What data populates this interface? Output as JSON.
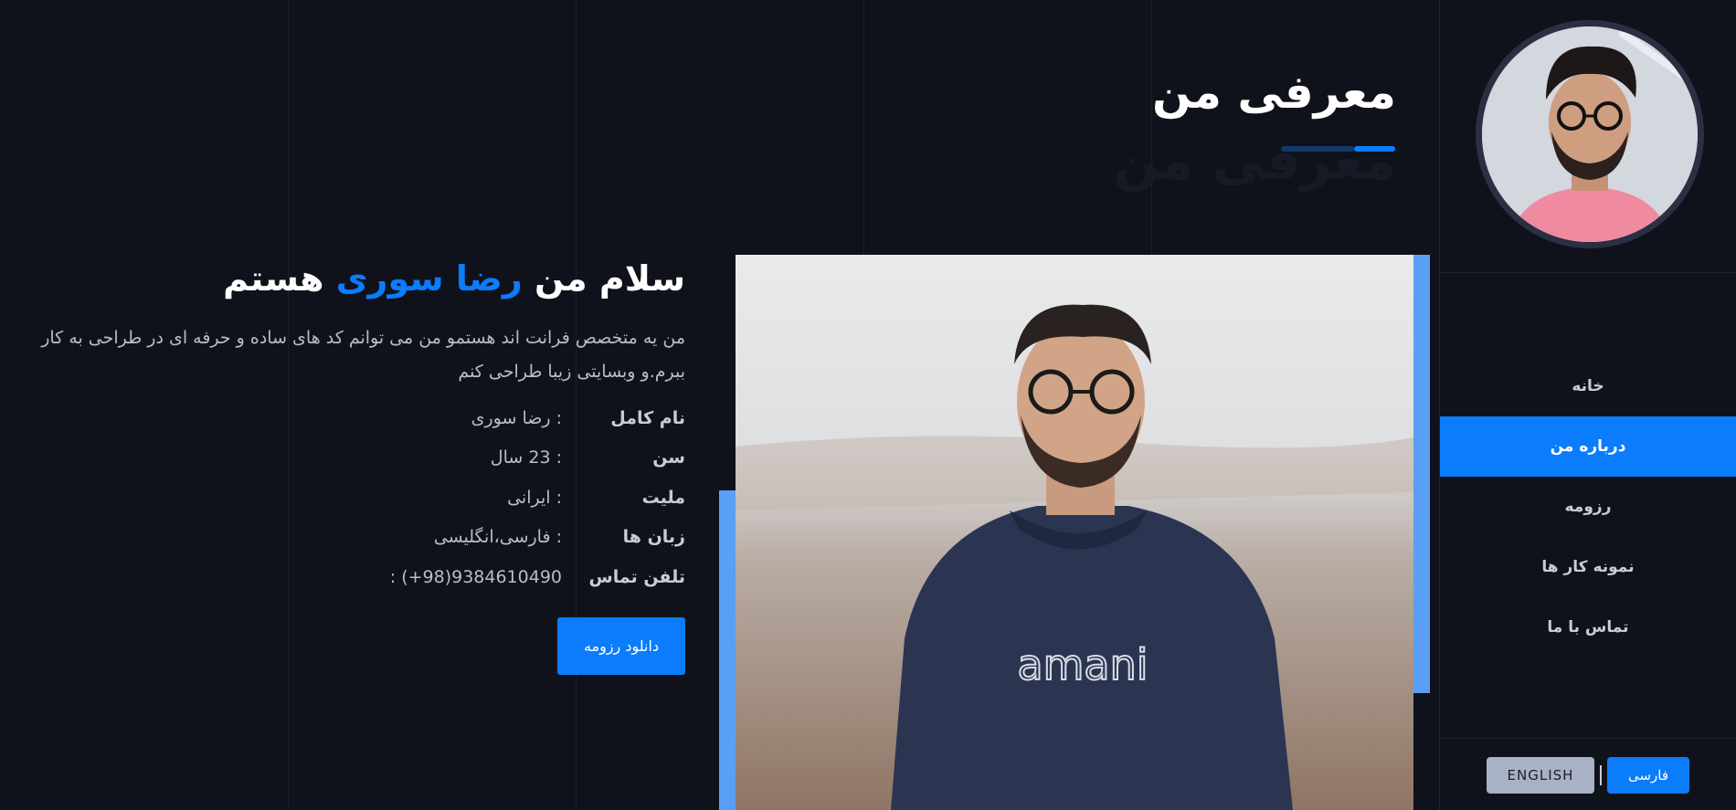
{
  "header": {
    "title": "معرفی من",
    "title_shadow": "معرفی من"
  },
  "sidebar": {
    "avatar_alt": "avatar",
    "items": [
      {
        "label": "خانه",
        "active": false
      },
      {
        "label": "درباره من",
        "active": true
      },
      {
        "label": "رزومه",
        "active": false
      },
      {
        "label": "نمونه کار ها",
        "active": false
      },
      {
        "label": "تماس با ما",
        "active": false
      }
    ],
    "languages": {
      "english": "ENGLISH",
      "farsi": "فارسی"
    }
  },
  "intro": {
    "greeting_before": "سلام من ",
    "greeting_name": "رضا سوری",
    "greeting_after": " هستم",
    "bio": "من یه متخصص فرانت اند هستمو من می توانم کد های ساده و حرفه ای در طراحی به کار ببرم.و وبسایتی زیبا طراحی کنم",
    "info": [
      {
        "label": "نام کامل",
        "value": ": رضا سوری"
      },
      {
        "label": "سن",
        "value": ": 23 سال"
      },
      {
        "label": "ملیت",
        "value": ": ایرانی"
      },
      {
        "label": "زبان ها",
        "value": ": فارسی،انگلیسی"
      },
      {
        "label": "تلفن تماس",
        "value": ": (+98)9384610490"
      }
    ],
    "download_label": "دانلود رزومه"
  },
  "photo": {
    "hoodie_text": "amani"
  },
  "colors": {
    "accent": "#0b7cfb",
    "background": "#10121b",
    "accent_bar": "#5a9ff5"
  }
}
